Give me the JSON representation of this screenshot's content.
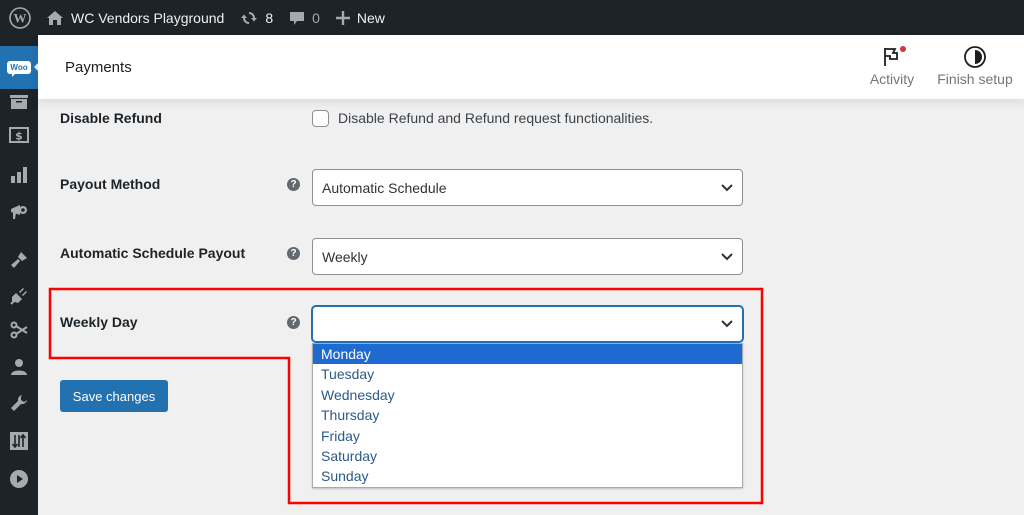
{
  "adminbar": {
    "site_name": "WC Vendors Playground",
    "updates_count": "8",
    "comments_count": "0",
    "new_label": "New"
  },
  "sidebar": {
    "items": [
      {
        "icon": "woocommerce-icon",
        "active": true,
        "label": "Woo"
      },
      {
        "icon": "archive-icon"
      },
      {
        "icon": "money-icon"
      },
      {
        "icon": "bar-chart-icon"
      },
      {
        "icon": "megaphone-icon"
      },
      {
        "icon": "paintbrush-icon"
      },
      {
        "icon": "plugin-icon"
      },
      {
        "icon": "scissors-icon"
      },
      {
        "icon": "user-icon"
      },
      {
        "icon": "wrench-icon"
      },
      {
        "icon": "sliders-icon"
      },
      {
        "icon": "play-circle-icon"
      }
    ]
  },
  "header": {
    "title": "Payments",
    "activity_label": "Activity",
    "finish_setup_label": "Finish setup"
  },
  "form": {
    "disable_refund": {
      "label": "Disable Refund",
      "checkbox_label": "Disable Refund and Refund request functionalities.",
      "checked": false
    },
    "payout_method": {
      "label": "Payout Method",
      "value": "Automatic Schedule"
    },
    "automatic_schedule_payout": {
      "label": "Automatic Schedule Payout",
      "value": "Weekly"
    },
    "weekly_day": {
      "label": "Weekly Day",
      "value": "",
      "options": [
        "Monday",
        "Tuesday",
        "Wednesday",
        "Thursday",
        "Friday",
        "Saturday",
        "Sunday"
      ],
      "highlighted": "Monday"
    },
    "help_glyph": "?",
    "save_label": "Save changes"
  },
  "colors": {
    "accent": "#2271b1",
    "annotation": "#ff0000",
    "dropdown_highlight": "#1f6ad1"
  }
}
